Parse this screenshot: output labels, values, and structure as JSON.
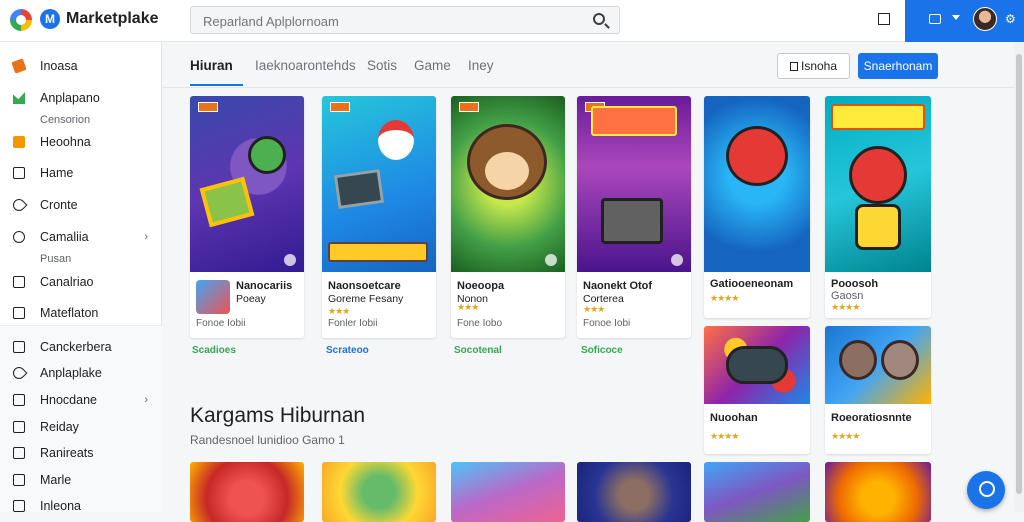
{
  "app": {
    "brand": "Marketplake"
  },
  "search": {
    "placeholder": "Reparland Aplplornoam"
  },
  "sidebar": {
    "items": [
      {
        "label": "Inoasa",
        "icon": "tag-icon",
        "sub": ""
      },
      {
        "label": "Anplapano",
        "icon": "chart-icon",
        "sub": "Censorion"
      },
      {
        "label": "Heoohna",
        "icon": "briefcase-icon",
        "sub": ""
      },
      {
        "label": "Hame",
        "icon": "square-icon",
        "sub": ""
      },
      {
        "label": "Cronte",
        "icon": "pen-icon",
        "sub": ""
      },
      {
        "label": "Camaliia",
        "icon": "circle-icon",
        "sub": "Pusan"
      },
      {
        "label": "Canalriao",
        "icon": "window-icon",
        "sub": ""
      },
      {
        "label": "Mateflaton",
        "icon": "list-icon",
        "sub": ""
      },
      {
        "label": "Canckerbera",
        "icon": "grid-icon",
        "sub": ""
      },
      {
        "label": "Anplaplake",
        "icon": "pen-icon",
        "sub": ""
      },
      {
        "label": "Hnocdane",
        "icon": "chart-line-icon",
        "sub": ""
      },
      {
        "label": "Reiday",
        "icon": "edit-icon",
        "sub": ""
      },
      {
        "label": "Ranireats",
        "icon": "document-icon",
        "sub": ""
      },
      {
        "label": "Marle",
        "icon": "edit-icon",
        "sub": ""
      },
      {
        "label": "Inleona",
        "icon": "document-icon",
        "sub": ""
      }
    ]
  },
  "tabs": [
    "Hiuran",
    "Iaeknoarontehds",
    "Sotis",
    "Game",
    "Iney"
  ],
  "actions": {
    "secondary": "Isnoha",
    "primary": "Snaerhonam"
  },
  "cards": [
    {
      "title": "Nanocariis",
      "subtitle": "Poeay",
      "stars": "★★★",
      "meta": "Fonoe Iobii",
      "tag": "Scadioes",
      "tag_color": "#34a853"
    },
    {
      "title": "Naonsoetcare",
      "subtitle": "Goreme Fesany",
      "stars": "★★★",
      "meta": "Fonler Iobii",
      "tag": "Scrateoo",
      "tag_color": "#1a73e8"
    },
    {
      "title": "Noeoopa",
      "subtitle": "Nonon",
      "stars": "★★★",
      "meta": "Fone Iobo",
      "tag": "Socotenal",
      "tag_color": "#34a853"
    },
    {
      "title": "Naonekt Otof",
      "subtitle": "Corterea",
      "stars": "★★★",
      "meta": "Fonoe Iobi",
      "tag": "Soficoce",
      "tag_color": "#34a853"
    }
  ],
  "right_cards": [
    {
      "title": "Gatiooeneonam",
      "stars": "★★★★"
    },
    {
      "title": "Pooosoh",
      "subtitle": "Gaosn",
      "stars": "★★★★"
    },
    {
      "title": "Nuoohan",
      "stars": "★★★★"
    },
    {
      "title": "Roeoratiosnnte",
      "stars": "★★★★"
    }
  ],
  "section": {
    "title": "Kargams Hiburnan",
    "subtitle": "Randesnoel lunidioo Gamo 1"
  }
}
